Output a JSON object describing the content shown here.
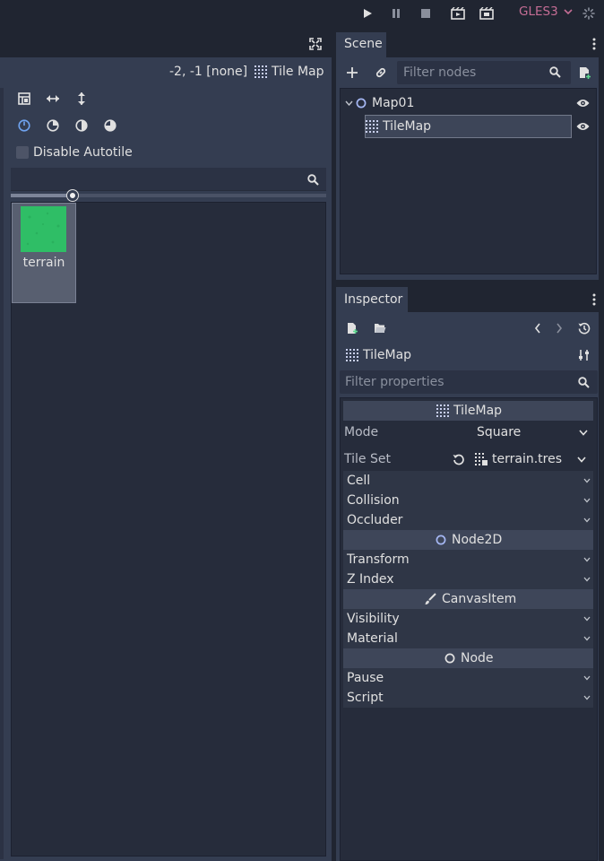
{
  "toolbar": {
    "renderer": "GLES3",
    "icons": [
      "play-icon",
      "pause-icon",
      "stop-icon",
      "play-scene-icon",
      "play-custom-scene-icon",
      "spinner-icon"
    ]
  },
  "tilemap_editor": {
    "coords_label": "-2, -1 [none]",
    "node_type_label": "Tile Map",
    "tool_icons": [
      "transform-icon",
      "flip-horizontal-icon",
      "flip-vertical-icon"
    ],
    "rotate_icons": [
      "rotate-0-icon",
      "rotate-90-icon",
      "rotate-180-icon",
      "rotate-270-icon"
    ],
    "disable_autotile_label": "Disable Autotile",
    "search_value": "",
    "tiles": [
      {
        "name": "terrain",
        "color": "#2fbe66"
      }
    ]
  },
  "scene_dock": {
    "tab_label": "Scene",
    "filter_placeholder": "Filter nodes",
    "tree": [
      {
        "name": "Map01",
        "icon": "node2d-circle-icon",
        "depth": 0
      },
      {
        "name": "TileMap",
        "icon": "tilemap-grid-icon",
        "depth": 1,
        "selected": true
      }
    ]
  },
  "inspector": {
    "tab_label": "Inspector",
    "node_name": "TileMap",
    "filter_placeholder": "Filter properties",
    "sections": {
      "tilemap": "TileMap",
      "node2d": "Node2D",
      "canvasitem": "CanvasItem",
      "node": "Node"
    },
    "props": {
      "mode_label": "Mode",
      "mode_value": "Square",
      "tileset_label": "Tile Set",
      "tileset_value": "terrain.tres",
      "cell": "Cell",
      "collision": "Collision",
      "occluder": "Occluder",
      "transform": "Transform",
      "z_index": "Z Index",
      "visibility": "Visibility",
      "material": "Material",
      "pause": "Pause",
      "script": "Script"
    }
  },
  "colors": {
    "accent": "#6fa3ef",
    "renderer": "#c56d95",
    "tile": "#2fbe66"
  }
}
